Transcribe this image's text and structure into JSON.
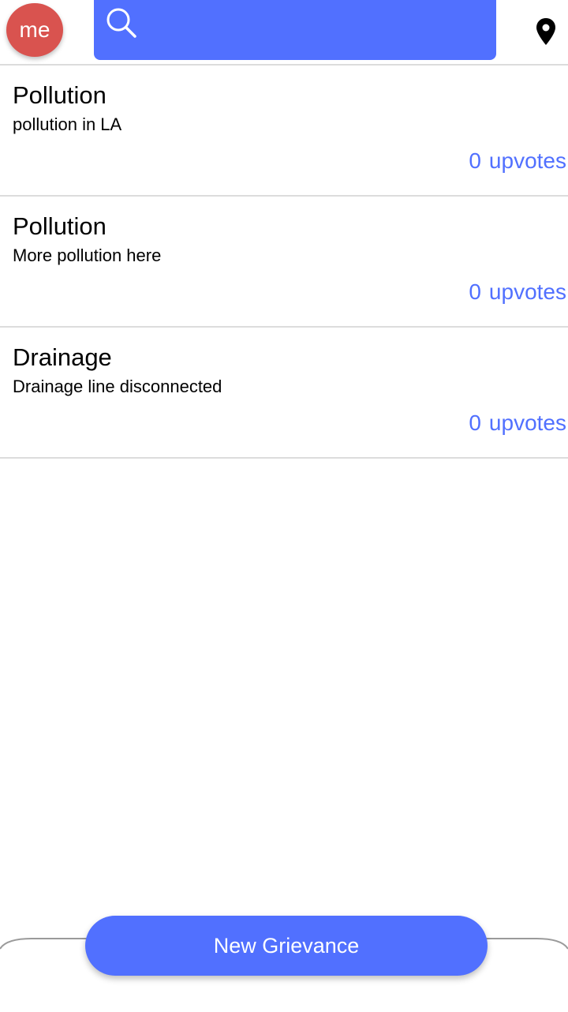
{
  "header": {
    "avatar_label": "me",
    "search_icon": "search-icon",
    "location_icon": "location-pin-icon"
  },
  "grievances": [
    {
      "title": "Pollution",
      "description": "pollution in LA",
      "upvote_count": "0",
      "upvote_label": "upvotes"
    },
    {
      "title": "Pollution",
      "description": "More pollution here",
      "upvote_count": "0",
      "upvote_label": "upvotes"
    },
    {
      "title": "Drainage",
      "description": "Drainage line disconnected",
      "upvote_count": "0",
      "upvote_label": "upvotes"
    }
  ],
  "footer": {
    "new_grievance_label": "New Grievance"
  },
  "colors": {
    "accent": "#5170ff",
    "avatar": "#d9534f",
    "divider": "#dcdcdc"
  }
}
